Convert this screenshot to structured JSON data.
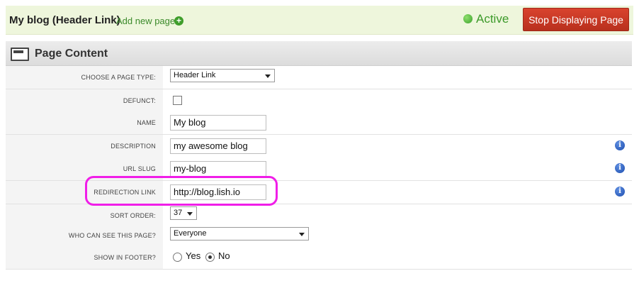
{
  "header": {
    "title": "My blog (Header Link)",
    "add_page_label": "Add new page",
    "add_icon": "plus-circle-icon",
    "status_label": "Active",
    "stop_button_label": "Stop Displaying Page"
  },
  "section": {
    "title": "Page Content",
    "icon": "window-icon"
  },
  "form": {
    "page_type": {
      "label": "CHOOSE A PAGE TYPE:",
      "value": "Header Link"
    },
    "defunct": {
      "label": "DEFUNCT:",
      "checked": false
    },
    "name": {
      "label": "NAME",
      "value": "My blog"
    },
    "description": {
      "label": "DESCRIPTION",
      "value": "my awesome blog"
    },
    "url_slug": {
      "label": "URL SLUG",
      "value": "my-blog"
    },
    "redirection_link": {
      "label": "REDIRECTION LINK",
      "value": "http://blog.lish.io"
    },
    "sort_order": {
      "label": "SORT ORDER:",
      "value": "37"
    },
    "visibility": {
      "label": "WHO CAN SEE THIS PAGE?",
      "value": "Everyone"
    },
    "show_in_footer": {
      "label": "SHOW IN FOOTER?",
      "yes_label": "Yes",
      "no_label": "No",
      "selected": "No"
    }
  },
  "colors": {
    "accent_green": "#3c9a2a",
    "stop_red": "#c8391f",
    "highlight_magenta": "#f01ee8",
    "info_blue": "#2a5cc0"
  }
}
